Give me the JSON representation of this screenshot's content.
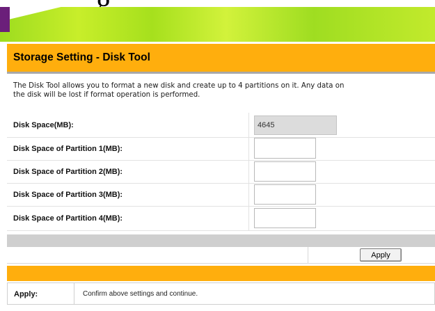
{
  "header": {
    "top_glyph": "g",
    "title": "Storage Setting - Disk Tool"
  },
  "description": {
    "line1": "The Disk Tool allows you to format a new disk and create up to 4 partitions on it. Any data on",
    "line2": "the disk will be lost if format operation is performed."
  },
  "form": {
    "disk_space": {
      "label": "Disk Space(MB):",
      "value": "4645"
    },
    "partitions": [
      {
        "label": "Disk Space of Partition 1(MB):",
        "value": ""
      },
      {
        "label": "Disk Space of Partition 2(MB):",
        "value": ""
      },
      {
        "label": "Disk Space of Partition 3(MB):",
        "value": ""
      },
      {
        "label": "Disk Space of Partition 4(MB):",
        "value": ""
      }
    ],
    "apply_label": "Apply"
  },
  "help": {
    "label": "Apply:",
    "text": "Confirm above settings and continue."
  },
  "colors": {
    "orange": "#ffae0d",
    "banner_green": "#b5e625",
    "banner_purple": "#6b1f7a"
  }
}
